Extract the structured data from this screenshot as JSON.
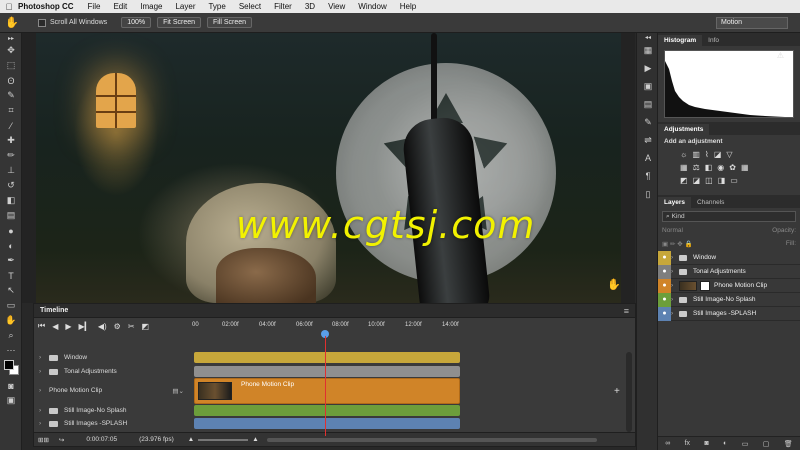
{
  "menubar": {
    "apple": "",
    "app_name": "Photoshop CC",
    "items": [
      "File",
      "Edit",
      "Image",
      "Layer",
      "Type",
      "Select",
      "Filter",
      "3D",
      "View",
      "Window",
      "Help"
    ]
  },
  "options": {
    "scroll_all": "Scroll All Windows",
    "zoom_100": "100%",
    "fit_screen": "Fit Screen",
    "fill_screen": "Fill Screen",
    "workspace": "Motion"
  },
  "canvas": {
    "watermark": "www.cgtsj.com"
  },
  "timeline": {
    "title": "Timeline",
    "ticks": [
      "00",
      "02:00f",
      "04:00f",
      "06:00f",
      "08:00f",
      "10:00f",
      "12:00f",
      "14:00f"
    ],
    "tracks": [
      {
        "label": "Window",
        "color": "#c7a73a"
      },
      {
        "label": "Tonal Adjustments",
        "color": "#8f8f8f"
      },
      {
        "label": "Phone Motion Clip",
        "color": "#d08428"
      },
      {
        "label": "Still Image-No Splash",
        "color": "#6c9e3b"
      },
      {
        "label": "Still Images -SPLASH",
        "color": "#5d82b2"
      }
    ],
    "clip_label": "Phone Motion Clip",
    "timecode": "0:00:07:05",
    "fps": "(23.976 fps)"
  },
  "panels": {
    "histogram_tab": "Histogram",
    "info_tab": "Info",
    "adjustments_tab": "Adjustments",
    "add_adjustment": "Add an adjustment",
    "layers_tab": "Layers",
    "channels_tab": "Channels",
    "kind_label": "Kind",
    "blend_mode": "Normal",
    "opacity_label": "Opacity:",
    "fill_label": "Fill:",
    "layers": [
      {
        "name": "Window",
        "eye_color": "#c7a73a"
      },
      {
        "name": "Tonal Adjustments",
        "eye_color": "#7e7e7e"
      },
      {
        "name": "Phone Motion Clip",
        "eye_color": "#d08428"
      },
      {
        "name": "Still Image-No Splash",
        "eye_color": "#6c9e3b"
      },
      {
        "name": "Still Images -SPLASH",
        "eye_color": "#5d82b2"
      }
    ]
  }
}
